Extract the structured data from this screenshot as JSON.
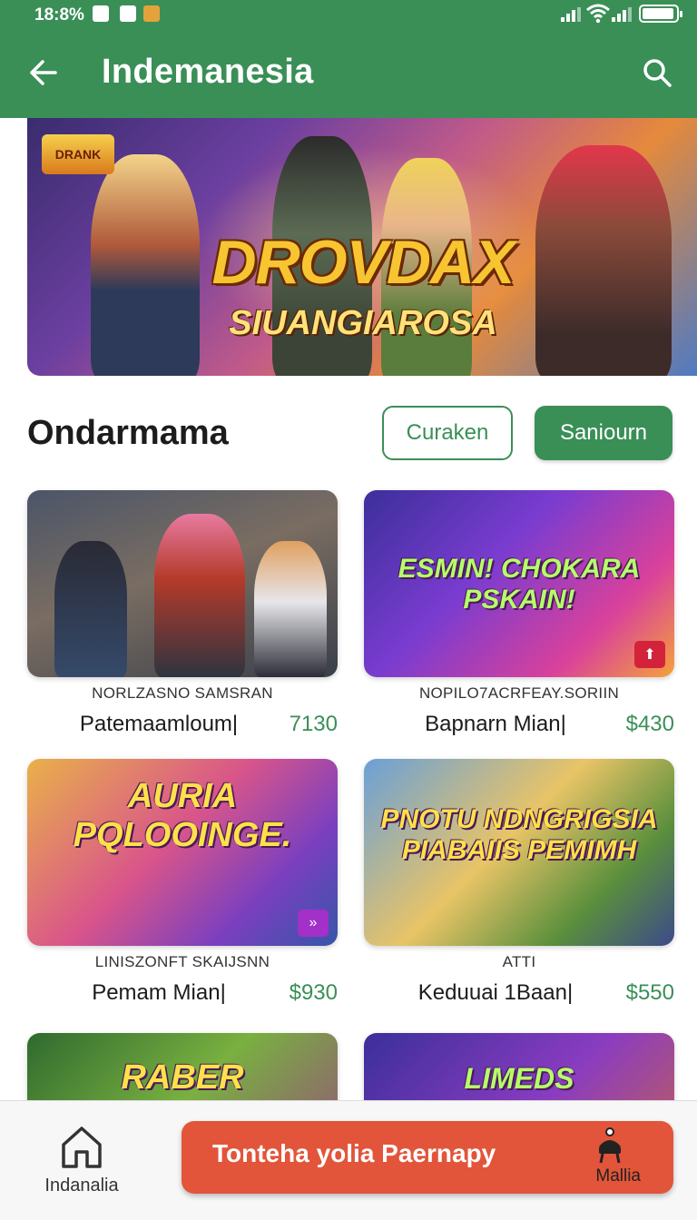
{
  "status_bar": {
    "time": "18:8%"
  },
  "app_bar": {
    "title": "Indemanesia",
    "back_icon": "arrow-left-icon",
    "search_icon": "search-icon"
  },
  "hero": {
    "brand_text": "DRANK",
    "title": "DROVDAX",
    "subtitle": "SIUANGIAROSA"
  },
  "section": {
    "title": "Ondarmama",
    "outline_button": "Curaken",
    "solid_button": "Saniourn"
  },
  "products": [
    {
      "thumb_text": "",
      "subtitle": "NORLZASNO SAMSRAN",
      "name": "Patemaamloum|",
      "price": "7130"
    },
    {
      "thumb_text": "ESMIN! CHOKARA PSKAIN!",
      "subtitle": "NOPILO7ACRFEAY.SORIIN",
      "name": "Bapnarn Mian|",
      "price": "$430"
    },
    {
      "thumb_text": "AURIA PQLOOINGE.",
      "subtitle": "LINISZONFT SKAIJSNN",
      "name": "Pemam Mian|",
      "price": "$930"
    },
    {
      "thumb_text": "PNOTU NDNGRIGSIA PIABAIIS PEMIMH",
      "subtitle": "ATTI",
      "name": "Keduuai 1Baan|",
      "price": "$550"
    },
    {
      "thumb_text": "RABER",
      "subtitle": "",
      "name": "",
      "price": ""
    },
    {
      "thumb_text": "LIMEDS",
      "subtitle": "",
      "name": "",
      "price": ""
    }
  ],
  "bottom_nav": {
    "home_label": "Indanalia",
    "cta_label": "Tonteha yolia Paernapy",
    "right_label": "Mallia"
  },
  "colors": {
    "primary": "#3a8f57",
    "accent": "#e2553a",
    "price": "#3a8f57"
  }
}
